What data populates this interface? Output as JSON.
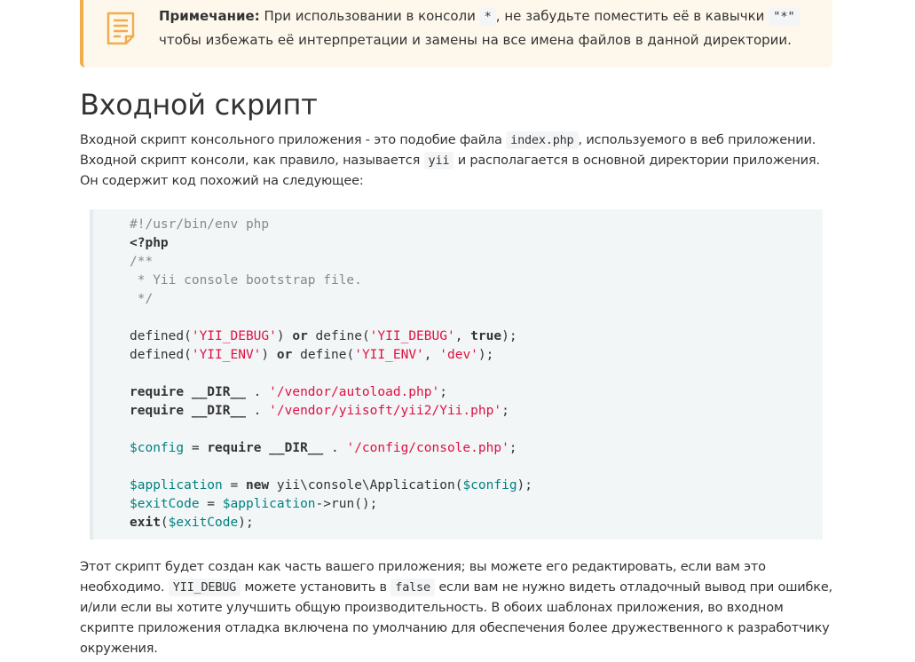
{
  "note": {
    "label": "Примечание:",
    "text_before": " При использовании в консоли ",
    "code_star": "*",
    "text_middle": ", не забудьте поместить её в кавычки ",
    "code_quoted_star": "\"*\"",
    "text_after": "чтобы избежать её интерпретации и замены на все имена файлов в данной директории."
  },
  "section": {
    "title": "Входной скрипт"
  },
  "intro": {
    "part1": "Входной скрипт консольного приложения - это подобие файла ",
    "code1": "index.php",
    "part2": ", используемого в веб приложении. Входной скрипт консоли, как правило, называется ",
    "code2": "yii",
    "part3": " и располагается в основной директории приложения. Он содержит код похожий на следующее:"
  },
  "code": {
    "line1": "#!/usr/bin/env php",
    "line2": "<?php",
    "line3": "/**",
    "line4": " * Yii console bootstrap file.",
    "line5": " */",
    "defined": "defined",
    "define": "define",
    "or": "or",
    "yii_debug": "'YII_DEBUG'",
    "yii_env": "'YII_ENV'",
    "true": "true",
    "dev": "'dev'",
    "require": "require",
    "dir": "__DIR__",
    "autoload": "'/vendor/autoload.php'",
    "yiiphp": "'/vendor/yiisoft/yii2/Yii.php'",
    "config_var": "$config",
    "config_path": "'/config/console.php'",
    "app_var": "$application",
    "new": "new",
    "app_class": "yii\\console\\Application",
    "exitcode_var": "$exitCode",
    "run": "->run();",
    "exit": "exit"
  },
  "outro": {
    "part1": "Этот скрипт будет создан как часть вашего приложения; вы можете его редактировать, если вам это необходимо. ",
    "code1": "YII_DEBUG",
    "part2": " можете установить в ",
    "code2": "false",
    "part3": " если вам не нужно видеть отладочный вывод при ошибке, и/или если вы хотите улучшить общую производительность. В обоих шаблонах приложения, во входном скрипте приложения отладка включена по умолчанию для обеспечения более дружественного к разработчику окружения."
  },
  "colors": {
    "note_bg": "#fef8ec",
    "note_border": "#f0ad4e",
    "code_bg": "#f3f6f7",
    "string": "#dd1144",
    "variable": "#008080",
    "comment": "#888888"
  }
}
